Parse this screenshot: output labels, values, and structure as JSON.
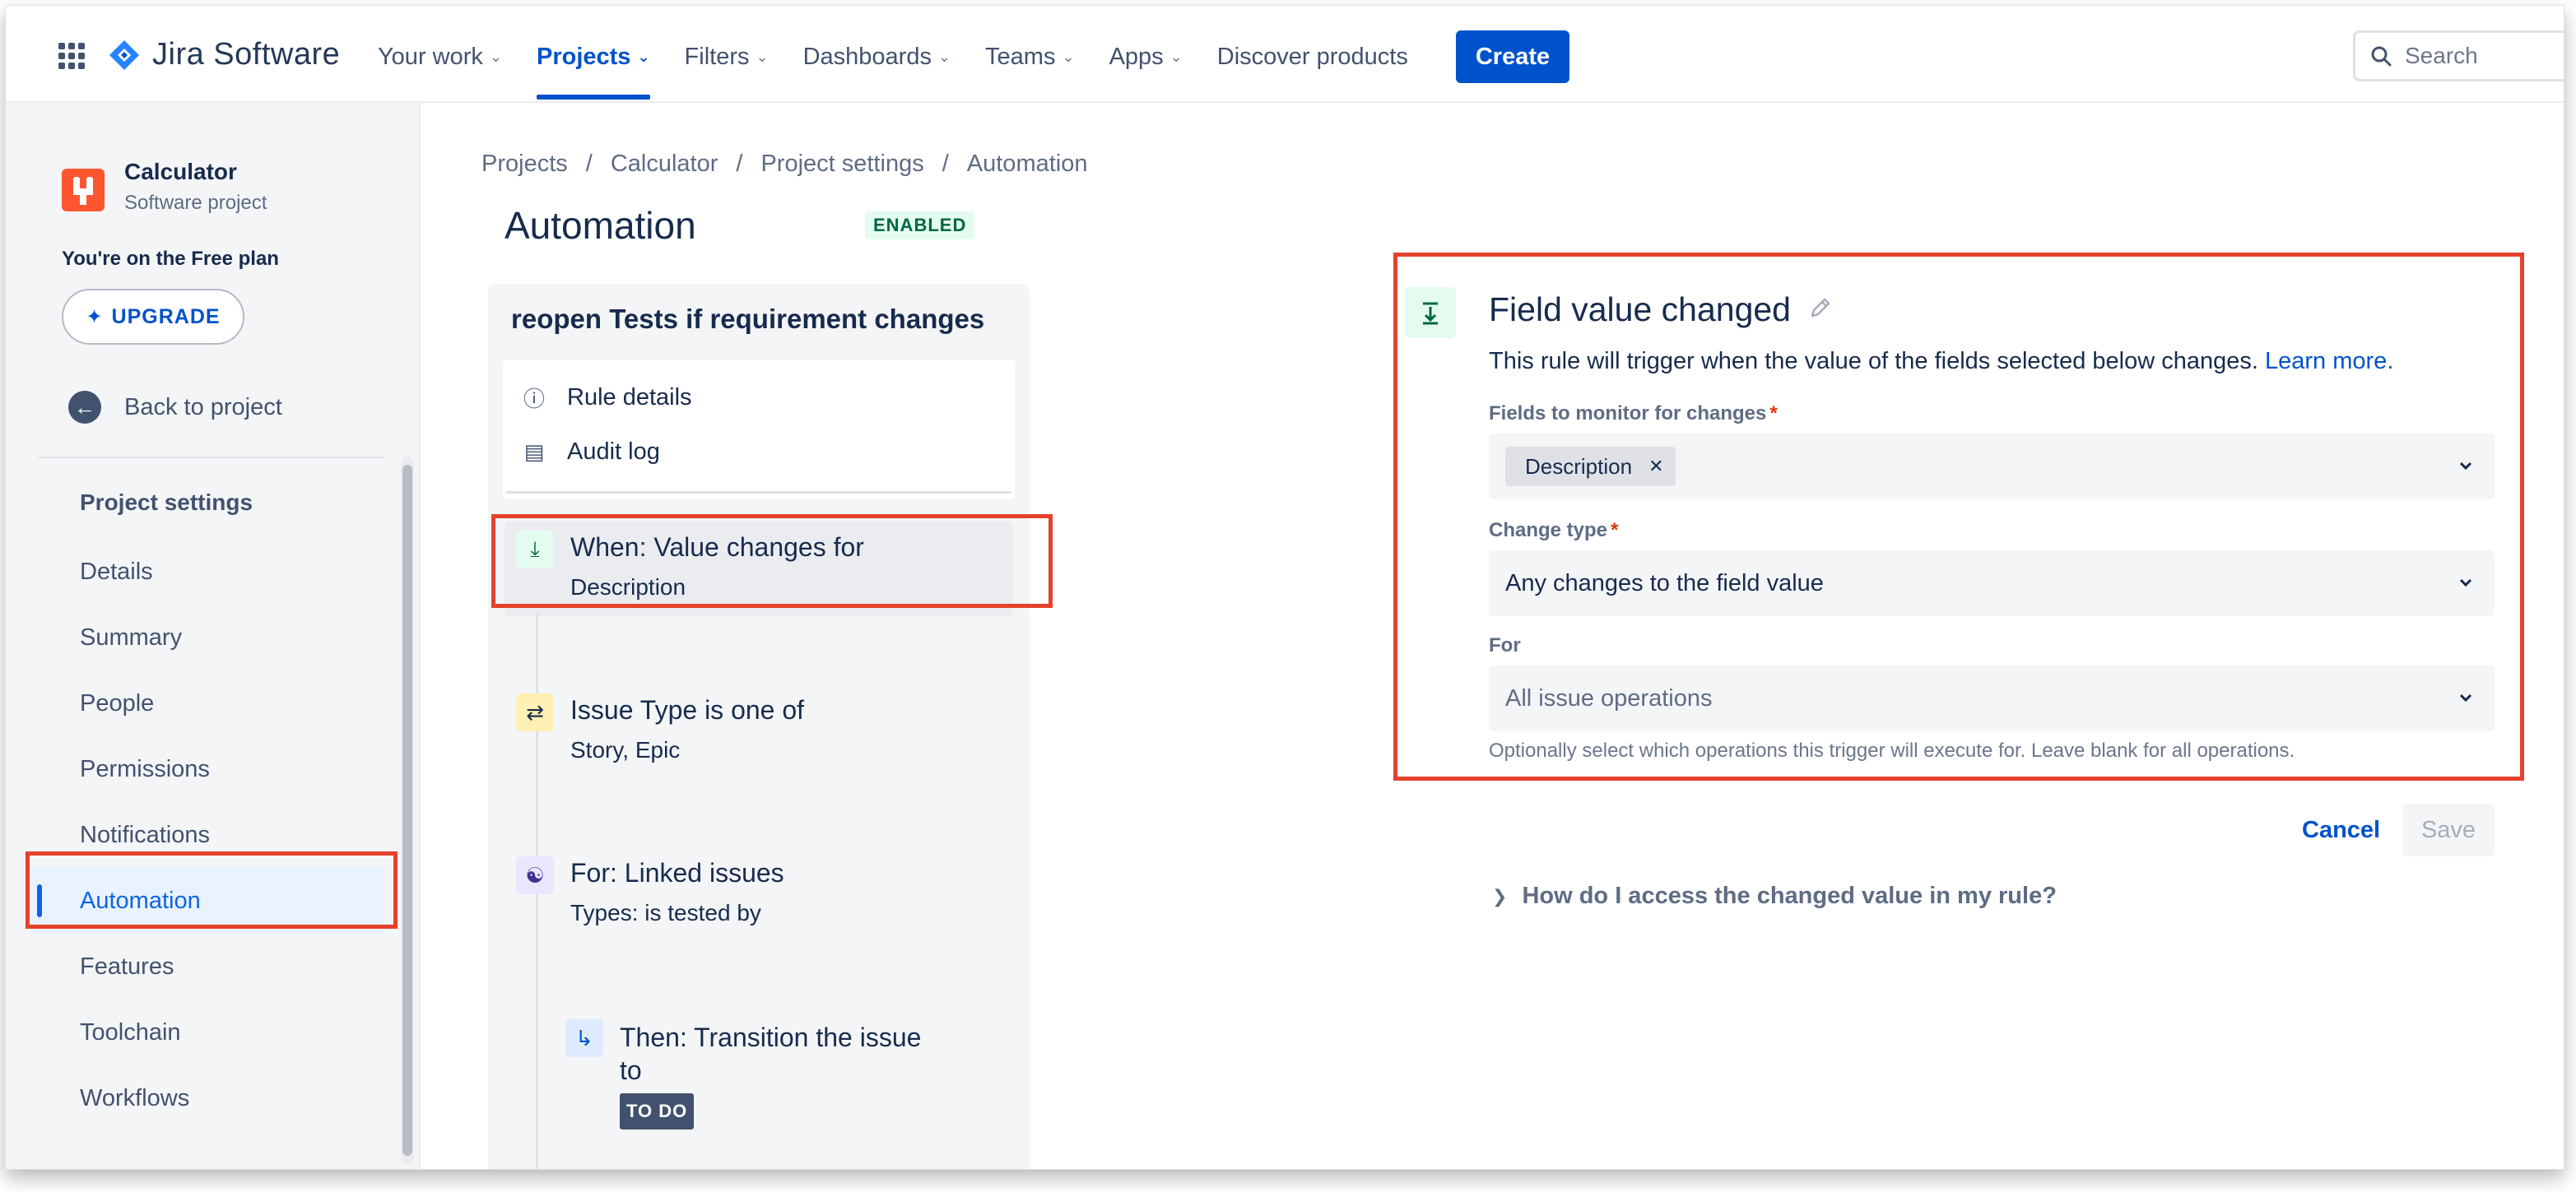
{
  "topnav": {
    "brand": "Jira Software",
    "items": [
      {
        "label": "Your work",
        "dropdown": true
      },
      {
        "label": "Projects",
        "dropdown": true,
        "active": true
      },
      {
        "label": "Filters",
        "dropdown": true
      },
      {
        "label": "Dashboards",
        "dropdown": true
      },
      {
        "label": "Teams",
        "dropdown": true
      },
      {
        "label": "Apps",
        "dropdown": true
      },
      {
        "label": "Discover products",
        "dropdown": false
      }
    ],
    "create_label": "Create",
    "search_placeholder": "Search"
  },
  "sidebar": {
    "project_name": "Calculator",
    "project_type": "Software project",
    "plan_text": "You're on the Free plan",
    "upgrade_label": "UPGRADE",
    "back_label": "Back to project",
    "section_title": "Project settings",
    "items": [
      {
        "label": "Details"
      },
      {
        "label": "Summary"
      },
      {
        "label": "People"
      },
      {
        "label": "Permissions"
      },
      {
        "label": "Notifications"
      },
      {
        "label": "Automation",
        "active": true
      },
      {
        "label": "Features"
      },
      {
        "label": "Toolchain"
      },
      {
        "label": "Workflows"
      }
    ]
  },
  "breadcrumb": [
    "Projects",
    "/",
    "Calculator",
    "/",
    "Project settings",
    "/",
    "Automation"
  ],
  "page": {
    "title": "Automation",
    "status_badge": "ENABLED"
  },
  "rule": {
    "title": "reopen Tests if requirement changes",
    "menu": {
      "rule_details": "Rule details",
      "audit_log": "Audit log"
    },
    "steps": {
      "trigger_title": "When: Value changes for",
      "trigger_sub": "Description",
      "condition_title": "Issue Type is one of",
      "condition_sub": "Story, Epic",
      "branch_title": "For: Linked issues",
      "branch_sub": "Types: is tested by",
      "action_title_1": "Then: Transition the issue",
      "action_title_2": "to",
      "action_badge": "TO DO"
    }
  },
  "config": {
    "title": "Field value changed",
    "description": "This rule will trigger when the value of the fields selected below changes.",
    "learn_more": "Learn more.",
    "fields_label": "Fields to monitor for changes",
    "fields_chip": "Description",
    "change_type_label": "Change type",
    "change_type_value": "Any changes to the field value",
    "for_label": "For",
    "for_placeholder": "All issue operations",
    "for_help": "Optionally select which operations this trigger will execute for. Leave blank for all operations.",
    "required_mark": "*",
    "cancel_label": "Cancel",
    "save_label": "Save",
    "howto_label": "How do I access the changed value in my rule?"
  },
  "colors": {
    "brand_blue": "#0052cc",
    "highlight_red": "#e5412b",
    "enabled_green": "#006644"
  }
}
